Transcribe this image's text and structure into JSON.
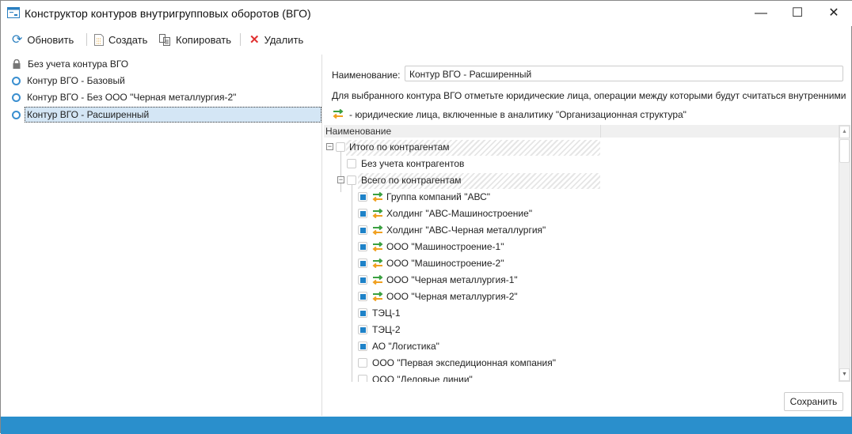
{
  "window": {
    "title": "Конструктор контуров внутригрупповых оборотов (ВГО)",
    "minimize": "—",
    "maximize": "☐",
    "close": "✕"
  },
  "toolbar": {
    "refresh": "Обновить",
    "create": "Создать",
    "copy": "Копировать",
    "delete": "Удалить"
  },
  "contours": [
    {
      "label": "Без учета контура ВГО",
      "icon": "lock-icon"
    },
    {
      "label": "Контур ВГО - Базовый",
      "icon": "circle-icon"
    },
    {
      "label": "Контур ВГО - Без ООО \"Черная металлургия-2\"",
      "icon": "circle-icon"
    },
    {
      "label": "Контур ВГО - Расширенный",
      "icon": "circle-icon",
      "selected": true
    }
  ],
  "form": {
    "name_label": "Наименование:",
    "name_value": "Контур ВГО - Расширенный",
    "hint": "Для выбранного контура ВГО отметьте юридические лица, операции между которыми будут считаться внутренними",
    "legend": "- юридические лица, включенные в аналитику \"Организационная структура\""
  },
  "tree": {
    "header": "Наименование",
    "rows": [
      {
        "label": "Итого по контрагентам",
        "level": 0,
        "checked": false,
        "expander": true,
        "hatched": true
      },
      {
        "label": "Без учета контрагентов",
        "level": 1,
        "checked": false
      },
      {
        "label": "Всего по контрагентам",
        "level": 1,
        "checked": false,
        "expander": true,
        "hatched": true
      },
      {
        "label": "Группа компаний \"АВС\"",
        "level": 2,
        "checked": true,
        "org": true
      },
      {
        "label": "Холдинг \"АВС-Машиностроение\"",
        "level": 2,
        "checked": true,
        "org": true
      },
      {
        "label": "Холдинг \"АВС-Черная металлургия\"",
        "level": 2,
        "checked": true,
        "org": true
      },
      {
        "label": "ООО \"Машиностроение-1\"",
        "level": 2,
        "checked": true,
        "org": true
      },
      {
        "label": "ООО \"Машиностроение-2\"",
        "level": 2,
        "checked": true,
        "org": true
      },
      {
        "label": "ООО \"Черная металлургия-1\"",
        "level": 2,
        "checked": true,
        "org": true
      },
      {
        "label": "ООО \"Черная металлургия-2\"",
        "level": 2,
        "checked": true,
        "org": true
      },
      {
        "label": "ТЭЦ-1",
        "level": 2,
        "checked": true
      },
      {
        "label": "ТЭЦ-2",
        "level": 2,
        "checked": true
      },
      {
        "label": "АО \"Логистика\"",
        "level": 2,
        "checked": true
      },
      {
        "label": "ООО \"Первая экспедиционная компания\"",
        "level": 2,
        "checked": false
      },
      {
        "label": "ООО \"Деловые линии\"",
        "level": 2,
        "checked": false
      }
    ]
  },
  "save": "Сохранить",
  "colors": {
    "accent": "#1e82c8",
    "status_bar": "#2a8fcc",
    "selection": "#d4e6f5"
  }
}
